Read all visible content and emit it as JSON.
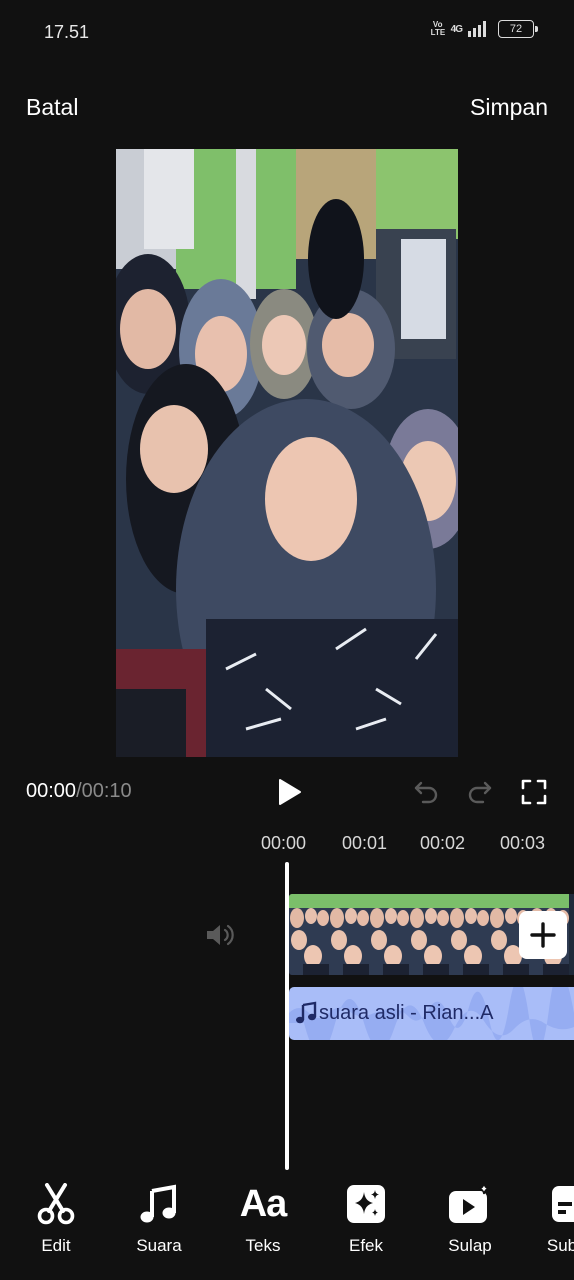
{
  "status_bar": {
    "time": "17.51",
    "volte": "Vo LTE",
    "network": "4G",
    "battery": "72"
  },
  "header": {
    "cancel_label": "Batal",
    "save_label": "Simpan"
  },
  "playback": {
    "current_time": "00:00",
    "separator": "/",
    "total_time": "00:10"
  },
  "timeline": {
    "ruler": [
      "00:00",
      "00:01",
      "00:02",
      "00:03"
    ],
    "audio_label": "suara asli - Rian...A"
  },
  "toolbar": {
    "items": [
      {
        "label": "Edit",
        "icon": "scissors-icon"
      },
      {
        "label": "Suara",
        "icon": "music-note-icon"
      },
      {
        "label": "Teks",
        "icon": "text-aa-icon"
      },
      {
        "label": "Efek",
        "icon": "sparkle-effect-icon"
      },
      {
        "label": "Sulap",
        "icon": "magic-video-icon"
      },
      {
        "label": "Sub",
        "icon": "subtitle-icon"
      }
    ]
  },
  "colors": {
    "background": "#111111",
    "audio_track": "#a9bdf8",
    "text_primary": "#ffffff",
    "text_muted": "#8a8a8a"
  }
}
